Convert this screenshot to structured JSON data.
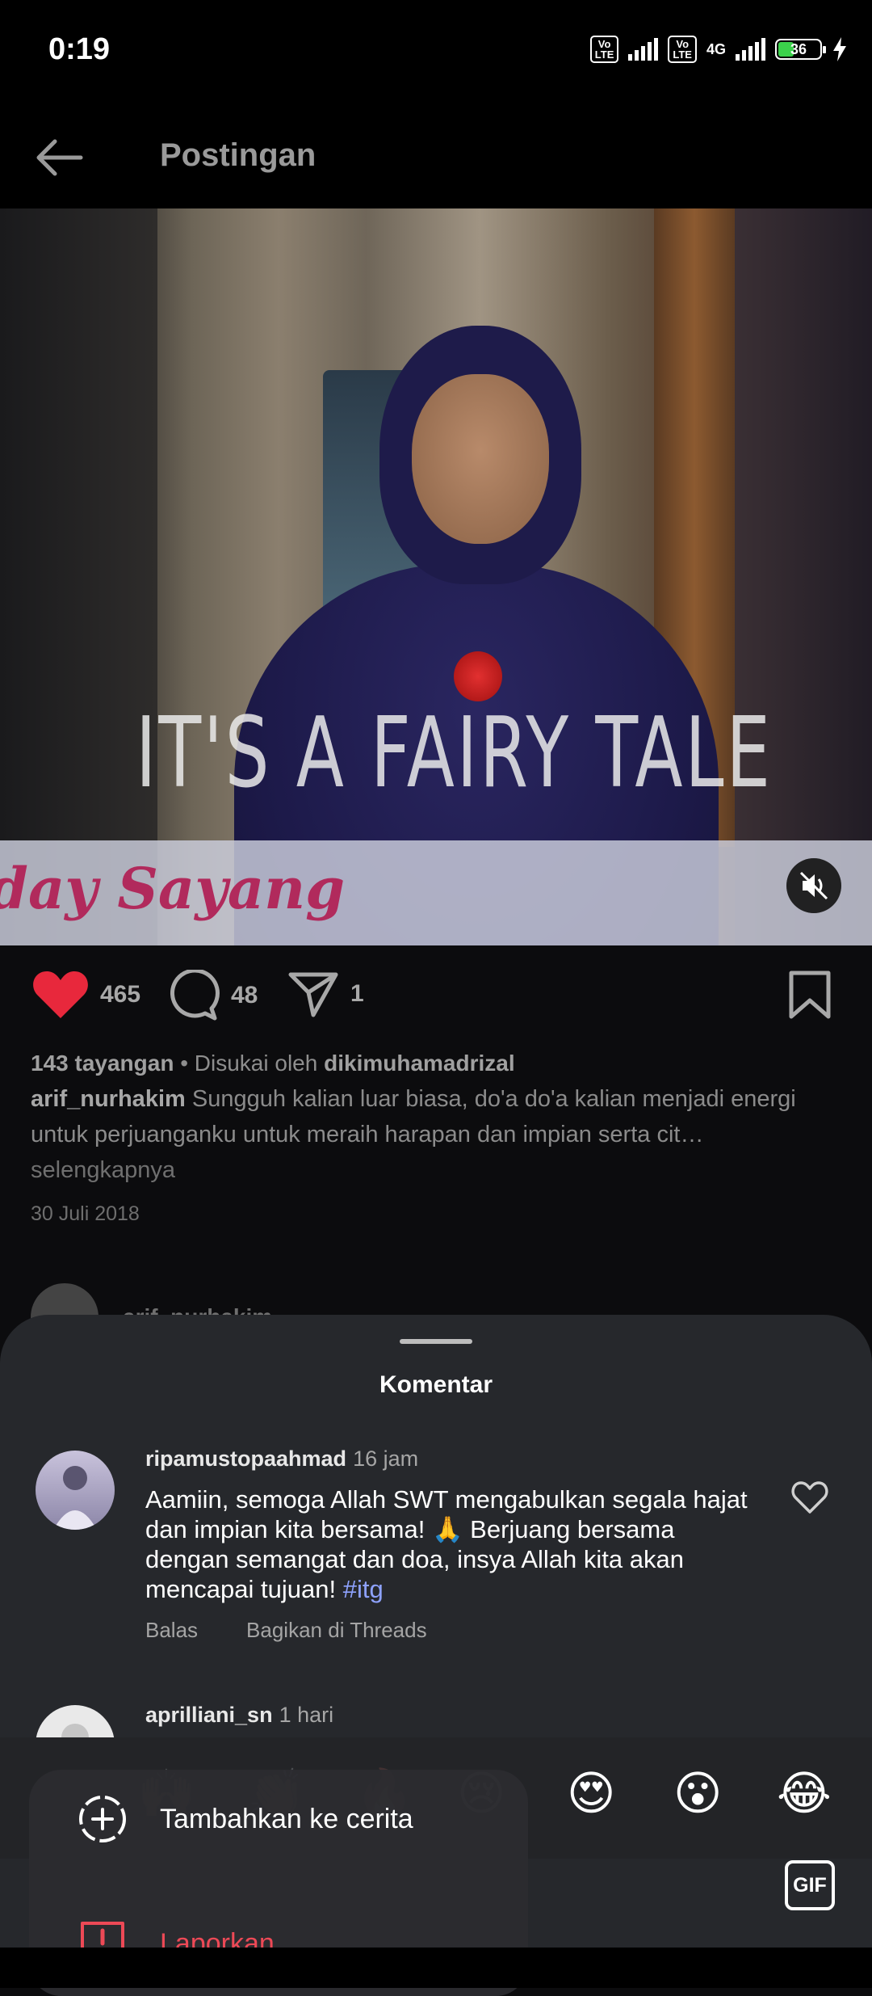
{
  "status_bar": {
    "time": "0:19",
    "volte1": "Vo\nLTE",
    "volte2": "Vo\nLTE",
    "network": "4G",
    "battery": "36"
  },
  "header": {
    "title": "Postingan"
  },
  "video": {
    "overlay_text": "IT'S A FAIRY TALE",
    "banner_text": "day Sayang"
  },
  "actions": {
    "likes": "465",
    "comments": "48",
    "shares": "1"
  },
  "post": {
    "views": "143 tayangan",
    "liked_by_prefix": "Disukai oleh",
    "liked_by_user": "dikimuhamadrizal",
    "caption_user": "arif_nurhakim",
    "caption_text": "Sungguh kalian luar biasa,  do'a do'a kalian menjadi energi untuk perjuanganku untuk meraih harapan dan impian serta cit…",
    "more": "selengkapnya",
    "date": "30 Juli 2018",
    "author_peek": "arif_nurhakim"
  },
  "comments_sheet": {
    "title": "Komentar",
    "comments": [
      {
        "user": "ripamustopaahmad",
        "time": "16 jam",
        "text": "Aamiin, semoga Allah SWT mengabulkan segala hajat dan impian kita bersama! 🙏 Berjuang bersama dengan semangat dan doa, insya Allah kita akan mencapai tujuan!",
        "hashtag": "#itg",
        "reply": "Balas",
        "share_threads": "Bagikan di Threads"
      },
      {
        "user": "aprilliani_sn",
        "time": "1 hari"
      }
    ]
  },
  "emoji_bar": {
    "dim_emojis": [
      "🙌",
      "👏",
      "🔥",
      "😢"
    ],
    "emojis": [
      "😍",
      "😮",
      "😂"
    ],
    "gif": "GIF"
  },
  "context_menu": {
    "add_to_story": "Tambahkan ke cerita",
    "report": "Laporkan"
  },
  "colors": {
    "like_red": "#e8283c",
    "report_red": "#ed4956",
    "hashtag": "#8ea2ff",
    "sheet_bg": "#26282c"
  }
}
